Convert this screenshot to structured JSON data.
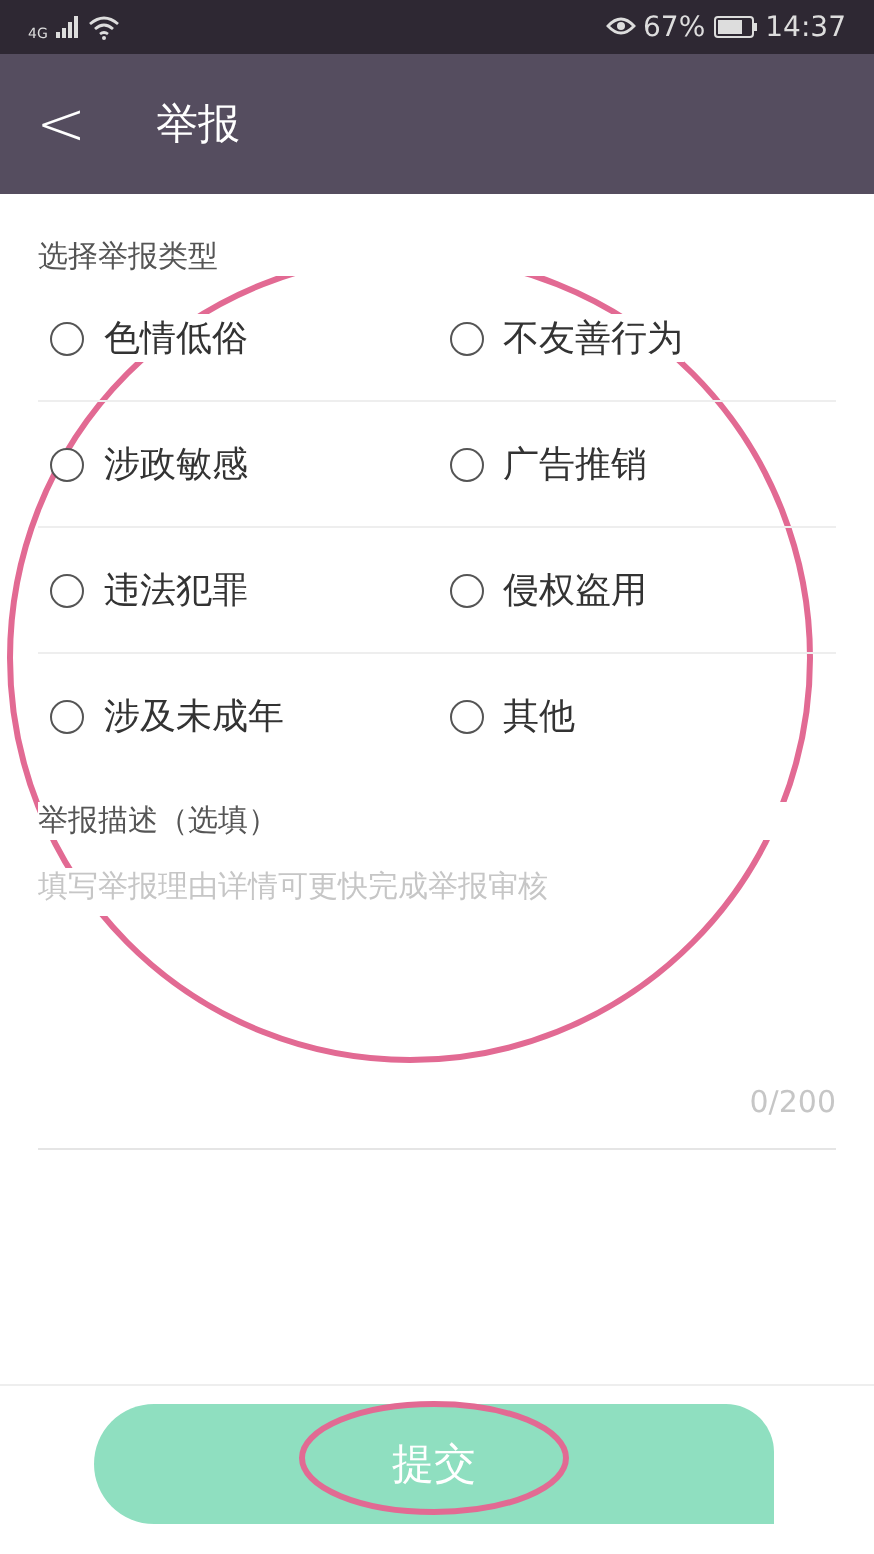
{
  "status_bar": {
    "network": "4G",
    "battery": "67%",
    "time": "14:37"
  },
  "header": {
    "back": "<",
    "title": "举报"
  },
  "report_type": {
    "label": "选择举报类型",
    "options": [
      {
        "label": "色情低俗",
        "selected": false
      },
      {
        "label": "不友善行为",
        "selected": false
      },
      {
        "label": "涉政敏感",
        "selected": false
      },
      {
        "label": "广告推销",
        "selected": false
      },
      {
        "label": "违法犯罪",
        "selected": false
      },
      {
        "label": "侵权盗用",
        "selected": false
      },
      {
        "label": "涉及未成年",
        "selected": false
      },
      {
        "label": "其他",
        "selected": false
      }
    ]
  },
  "description": {
    "label": "举报描述（选填）",
    "placeholder": "填写举报理由详情可更快完成举报审核",
    "counter": "0/200"
  },
  "submit": {
    "label": "提交"
  }
}
